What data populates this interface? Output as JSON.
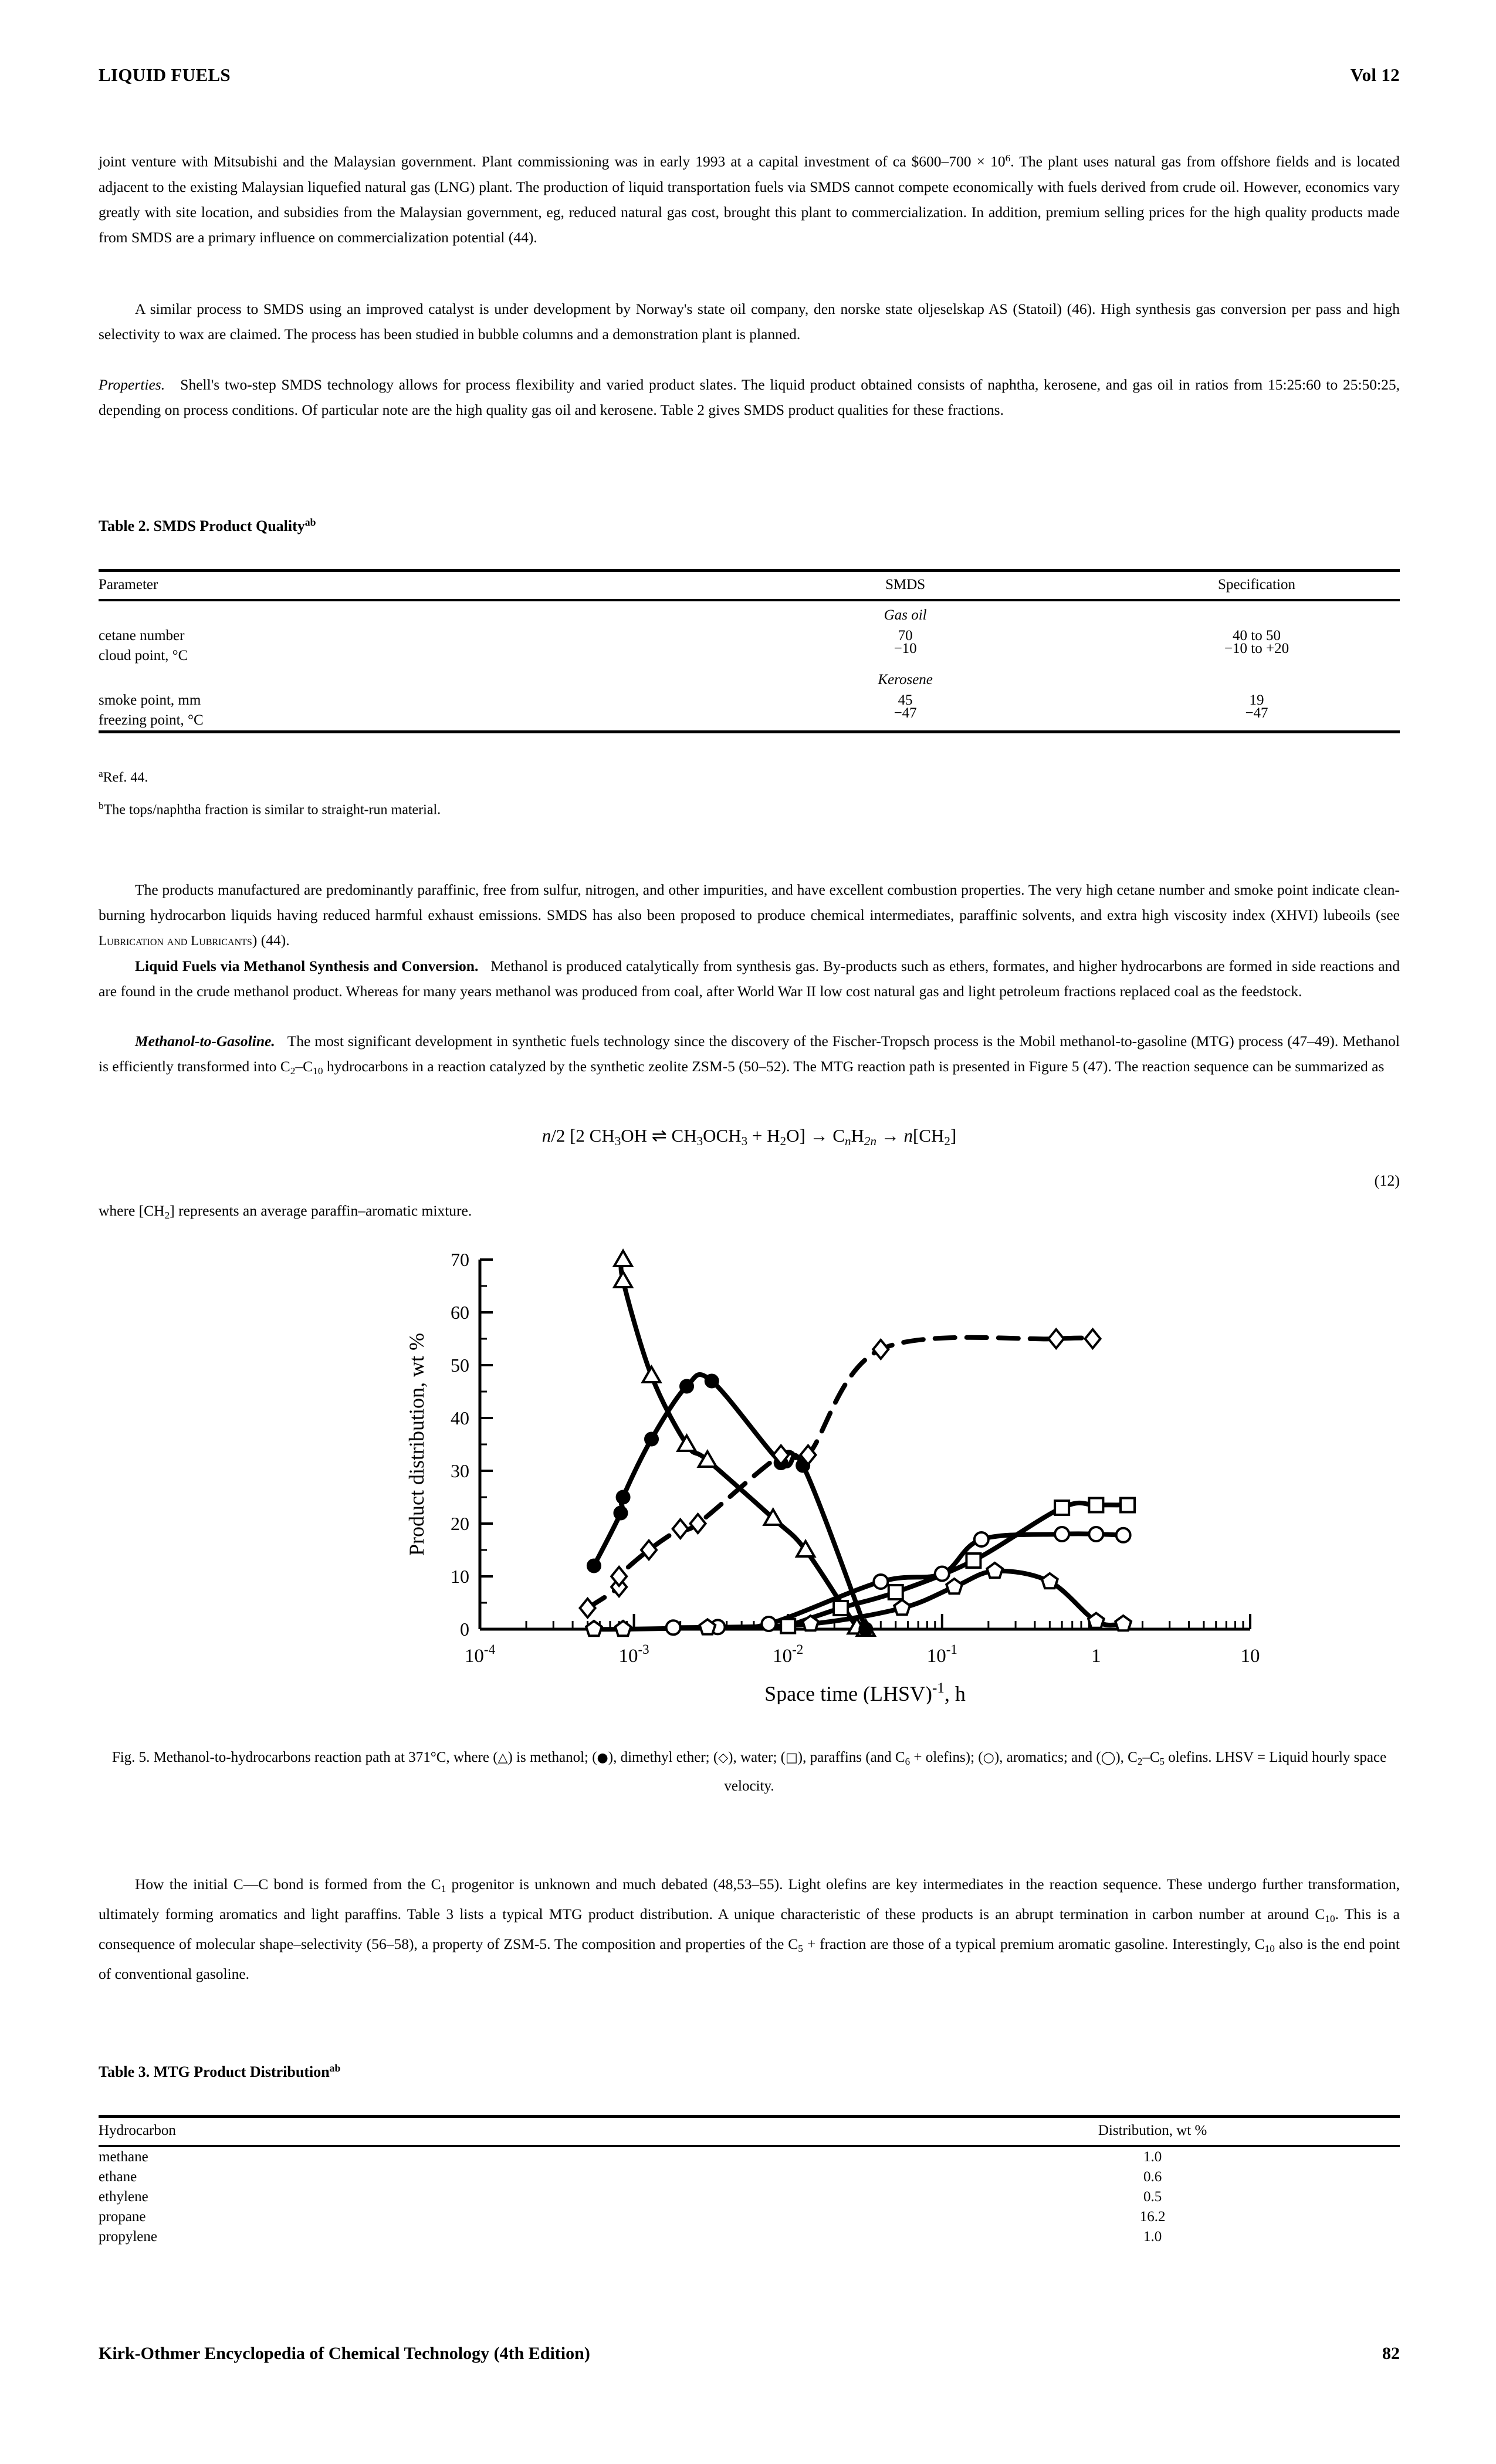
{
  "runhead": {
    "left": "LIQUID FUELS",
    "right": "Vol 12"
  },
  "para1": {
    "line": "joint venture with Mitsubishi and the Malaysian government. Plant commissioning was in early 1993 at a capital investment of ca $600–700 × 10",
    "exp": "6",
    "rest": ". The plant uses natural gas from offshore fields and is located adjacent to the existing Malaysian liquefied natural gas (LNG) plant. The production of liquid transportation fuels via SMDS cannot compete economically with fuels derived from crude oil. However, economics vary greatly with site location, and subsidies from the Malaysian government, eg, reduced natural gas cost, brought this plant to commercialization. In addition, premium selling prices for the high quality products made from SMDS are a primary influence on commercialization potential (44)."
  },
  "para2": "A similar process to SMDS using an improved catalyst is under development by Norway's state oil company, den norske state oljeselskap AS (Statoil) (46). High synthesis gas conversion per pass and high selectivity to wax are claimed. The process has been studied in bubble columns and a demonstration plant is planned.",
  "para3": {
    "lead": "Properties.",
    "text": "Shell's two-step SMDS technology allows for process flexibility and varied product slates. The liquid product obtained consists of naphtha, kerosene, and gas oil in ratios from 15:25:60 to 25:50:25, depending on process conditions. Of particular note are the high quality gas oil and kerosene. Table 2 gives SMDS product qualities for these fractions."
  },
  "table2": {
    "title": "Table 2. SMDS Product Quality",
    "title_sup_a": "a",
    "title_sup_b": "b",
    "headers": [
      "Parameter",
      "SMDS",
      "Specification"
    ],
    "sections": [
      {
        "name": "Gas oil",
        "rows": [
          {
            "parameter": "cetane number",
            "smds": "70",
            "spec": "40 to 50"
          },
          {
            "parameter": "cloud point, °C",
            "smds": "−10",
            "spec": "−10 to +20"
          }
        ]
      },
      {
        "name": "Kerosene",
        "rows": [
          {
            "parameter": "smoke point, mm",
            "smds": "45",
            "spec": "19"
          },
          {
            "parameter": "freezing point, °C",
            "smds": "−47",
            "spec": "−47"
          }
        ]
      }
    ],
    "footnotes": [
      {
        "mark": "a",
        "text": "Ref. 44."
      },
      {
        "mark": "b",
        "text": "The tops/naphtha fraction is similar to straight-run material."
      }
    ]
  },
  "para4": "The products manufactured are predominantly paraffinic, free from sulfur, nitrogen, and other impurities, and have excellent combustion properties. The very high cetane number and smoke point indicate clean-burning hydrocarbon liquids having reduced harmful exhaust emissions. SMDS has also been proposed to produce chemical intermediates, paraffinic solvents, and extra high viscosity index (XHVI) lubeoils (see ",
  "para4_sc": "Lubrication and Lubricants",
  "para4_end": ") (44).",
  "para5": {
    "lead": "Liquid Fuels via Methanol Synthesis and Conversion.",
    "text": "Methanol is produced catalytically from synthesis gas. By-products such as ethers, formates, and higher hydrocarbons are formed in side reactions and are found in the crude methanol product. Whereas for many years methanol was produced from coal, after World War II low cost natural gas and light petroleum fractions replaced coal as the feedstock."
  },
  "para6": {
    "lead": "Methanol-to-Gasoline.",
    "t1": "The most significant development in synthetic fuels technology since the discovery of the Fischer-Tropsch process is the Mobil methanol-to-gasoline (MTG) process (47–49). Methanol is efficiently transformed into C",
    "s1": "2",
    "t2": "–C",
    "s2": "10",
    "t3": " hydrocarbons in a reaction catalyzed by the synthetic zeolite ZSM-5 (50–52). The MTG reaction path is presented in Figure 5 (47). The reaction sequence can be summarized as"
  },
  "equation": {
    "text": "n/2 [2 CH3OH ⇌ CH3OCH3 + H2O] → CnH2n → n[CH2]",
    "number": "(12)"
  },
  "para7": {
    "pre": "where [CH",
    "sub": "2",
    "post": "] represents an average paraffin–aromatic mixture."
  },
  "figure": {
    "caption_parts": {
      "p1": "Fig. 5. Methanol-to-hydrocarbons reaction path at 371°C, where (",
      "s_tri": "△",
      "p2": ") is methanol; (",
      "s_fdot": "●",
      "p3": "), dimethyl ether; (",
      "s_dia": "◇",
      "p4": "), water; (",
      "s_sq": "□",
      "p5": "), paraffins (and C",
      "sub6": "6",
      "p6": " + olefins); (",
      "s_cir": "○",
      "p7": "), aromatics; and (",
      "s_cir2": "◯",
      "p8": "), C",
      "sub2": "2",
      "p9": "–C",
      "sub5": "5",
      "p10": " olefins. LHSV = Liquid hourly space velocity."
    }
  },
  "chart_data": {
    "type": "line",
    "title": "",
    "xlabel": "Space time (LHSV)-1, h",
    "xlabel_parts": {
      "pre": "Space time (LHSV)",
      "sup": "-1",
      "post": ", h"
    },
    "ylabel": "Product distribution, wt %",
    "xscale": "log",
    "xlim": [
      0.0001,
      10
    ],
    "ylim": [
      0,
      70
    ],
    "xticks": [
      "10-4",
      "10-3",
      "10-2",
      "10-1",
      "1",
      "10"
    ],
    "xtick_values": [
      0.0001,
      0.001,
      0.01,
      0.1,
      1,
      10
    ],
    "yticks": [
      0,
      10,
      20,
      30,
      40,
      50,
      60,
      70
    ],
    "grid": false,
    "legend": "in-caption",
    "series": [
      {
        "name": "methanol",
        "marker": "open-triangle",
        "style": "solid",
        "points": [
          [
            0.00085,
            70
          ],
          [
            0.00085,
            66
          ],
          [
            0.0013,
            48
          ],
          [
            0.0022,
            35
          ],
          [
            0.003,
            32
          ],
          [
            0.008,
            21
          ],
          [
            0.013,
            15
          ],
          [
            0.028,
            0.4
          ],
          [
            0.032,
            0
          ]
        ]
      },
      {
        "name": "dimethyl ether",
        "marker": "filled-circle",
        "style": "solid",
        "points": [
          [
            0.00055,
            12
          ],
          [
            0.00082,
            22
          ],
          [
            0.00085,
            25
          ],
          [
            0.0013,
            36
          ],
          [
            0.0022,
            46
          ],
          [
            0.0032,
            47
          ],
          [
            0.009,
            31.5
          ],
          [
            0.0125,
            31
          ],
          [
            0.032,
            0
          ]
        ]
      },
      {
        "name": "water",
        "marker": "open-diamond",
        "style": "dashed",
        "points": [
          [
            0.0005,
            4
          ],
          [
            0.0008,
            8
          ],
          [
            0.0008,
            10
          ],
          [
            0.00125,
            15
          ],
          [
            0.002,
            19
          ],
          [
            0.0026,
            20
          ],
          [
            0.009,
            33
          ],
          [
            0.0135,
            33
          ],
          [
            0.04,
            53
          ],
          [
            0.55,
            55
          ],
          [
            0.95,
            55
          ]
        ]
      },
      {
        "name": "paraffins (and C6 + olefins)",
        "marker": "open-square",
        "style": "solid",
        "points": [
          [
            0.01,
            0.6
          ],
          [
            0.022,
            4
          ],
          [
            0.05,
            7
          ],
          [
            0.16,
            13
          ],
          [
            0.6,
            23
          ],
          [
            1.0,
            23.5
          ],
          [
            1.6,
            23.5
          ]
        ]
      },
      {
        "name": "aromatics",
        "marker": "open-circle",
        "style": "solid",
        "points": [
          [
            0.0018,
            0.3
          ],
          [
            0.0035,
            0.4
          ],
          [
            0.0075,
            1.0
          ],
          [
            0.04,
            9
          ],
          [
            0.1,
            10.5
          ],
          [
            0.18,
            17
          ],
          [
            0.6,
            18
          ],
          [
            1.0,
            18
          ],
          [
            1.5,
            17.8
          ]
        ]
      },
      {
        "name": "C2-C5 olefins",
        "marker": "open-pentagon",
        "style": "solid",
        "points": [
          [
            0.00055,
            0
          ],
          [
            0.00085,
            0
          ],
          [
            0.003,
            0.3
          ],
          [
            0.014,
            1.0
          ],
          [
            0.055,
            4
          ],
          [
            0.12,
            8
          ],
          [
            0.22,
            11
          ],
          [
            0.5,
            9
          ],
          [
            1.0,
            1.5
          ],
          [
            1.5,
            1.0
          ]
        ]
      }
    ]
  },
  "para8": {
    "t1": "How the initial C—C bond is formed from the C",
    "s1": "1",
    "t2": " progenitor is unknown and much debated (48,53–55). Light olefins are key intermediates in the reaction sequence. These undergo further transformation, ultimately forming aromatics and light paraffins. Table 3 lists a typical MTG product distribution. A unique characteristic of these products is an abrupt termination in carbon number at around C",
    "s2": "10",
    "t3": ". This is a consequence of molecular shape–selectivity (56–58), a property of ZSM-5. The composition and properties of the C",
    "s3": "5",
    "t4": " + fraction are those of a typical premium aromatic gasoline. Interestingly, C",
    "s4": "10",
    "t5": " also is the end point of conventional gasoline."
  },
  "table3": {
    "title": "Table 3. MTG Product Distribution",
    "title_sup_a": "a",
    "title_sup_b": "b",
    "headers": [
      "Hydrocarbon",
      "Distribution, wt %"
    ],
    "rows": [
      {
        "hydrocarbon": "methane",
        "distribution": "1.0"
      },
      {
        "hydrocarbon": "ethane",
        "distribution": "0.6"
      },
      {
        "hydrocarbon": "ethylene",
        "distribution": "0.5"
      },
      {
        "hydrocarbon": "propane",
        "distribution": "16.2"
      },
      {
        "hydrocarbon": "propylene",
        "distribution": "1.0"
      }
    ]
  },
  "footer": {
    "left": "Kirk-Othmer Encyclopedia of Chemical Technology (4th Edition)",
    "page": "82"
  }
}
